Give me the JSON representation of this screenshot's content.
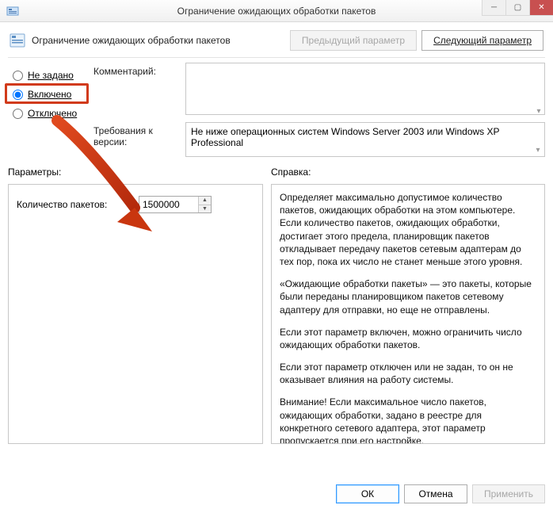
{
  "window": {
    "title": "Ограничение ожидающих обработки пакетов"
  },
  "header": {
    "label": "Ограничение ожидающих обработки пакетов",
    "prev_btn": "Предыдущий параметр",
    "next_btn": "Следующий параметр"
  },
  "radios": {
    "not_configured": "Не задано",
    "enabled": "Включено",
    "disabled": "Отключено",
    "selected": "enabled"
  },
  "fields": {
    "comment_label": "Комментарий:",
    "comment_value": "",
    "version_label": "Требования к версии:",
    "version_value": "Не ниже операционных систем Windows Server 2003 или Windows XP Professional"
  },
  "section_labels": {
    "params": "Параметры:",
    "help": "Справка:"
  },
  "params": {
    "packet_count_label": "Количество пакетов:",
    "packet_count_value": "1500000"
  },
  "help": {
    "p1": "Определяет максимально допустимое количество пакетов, ожидающих обработки на этом компьютере. Если количество пакетов, ожидающих обработки, достигает этого предела, планировщик пакетов откладывает передачу пакетов сетевым адаптерам до тех пор, пока их число не станет меньше этого уровня.",
    "p2": "«Ожидающие обработки пакеты» — это пакеты, которые были переданы планировщиком пакетов сетевому адаптеру для отправки, но еще не отправлены.",
    "p3": "Если этот параметр включен, можно ограничить число ожидающих обработки пакетов.",
    "p4": "Если этот параметр отключен или не задан, то он не оказывает влияния на работу системы.",
    "p5": "Внимание! Если максимальное число пакетов, ожидающих обработки, задано в реестре для конкретного сетевого адаптера, этот параметр пропускается при его настройке."
  },
  "footer": {
    "ok": "ОК",
    "cancel": "Отмена",
    "apply": "Применить"
  }
}
